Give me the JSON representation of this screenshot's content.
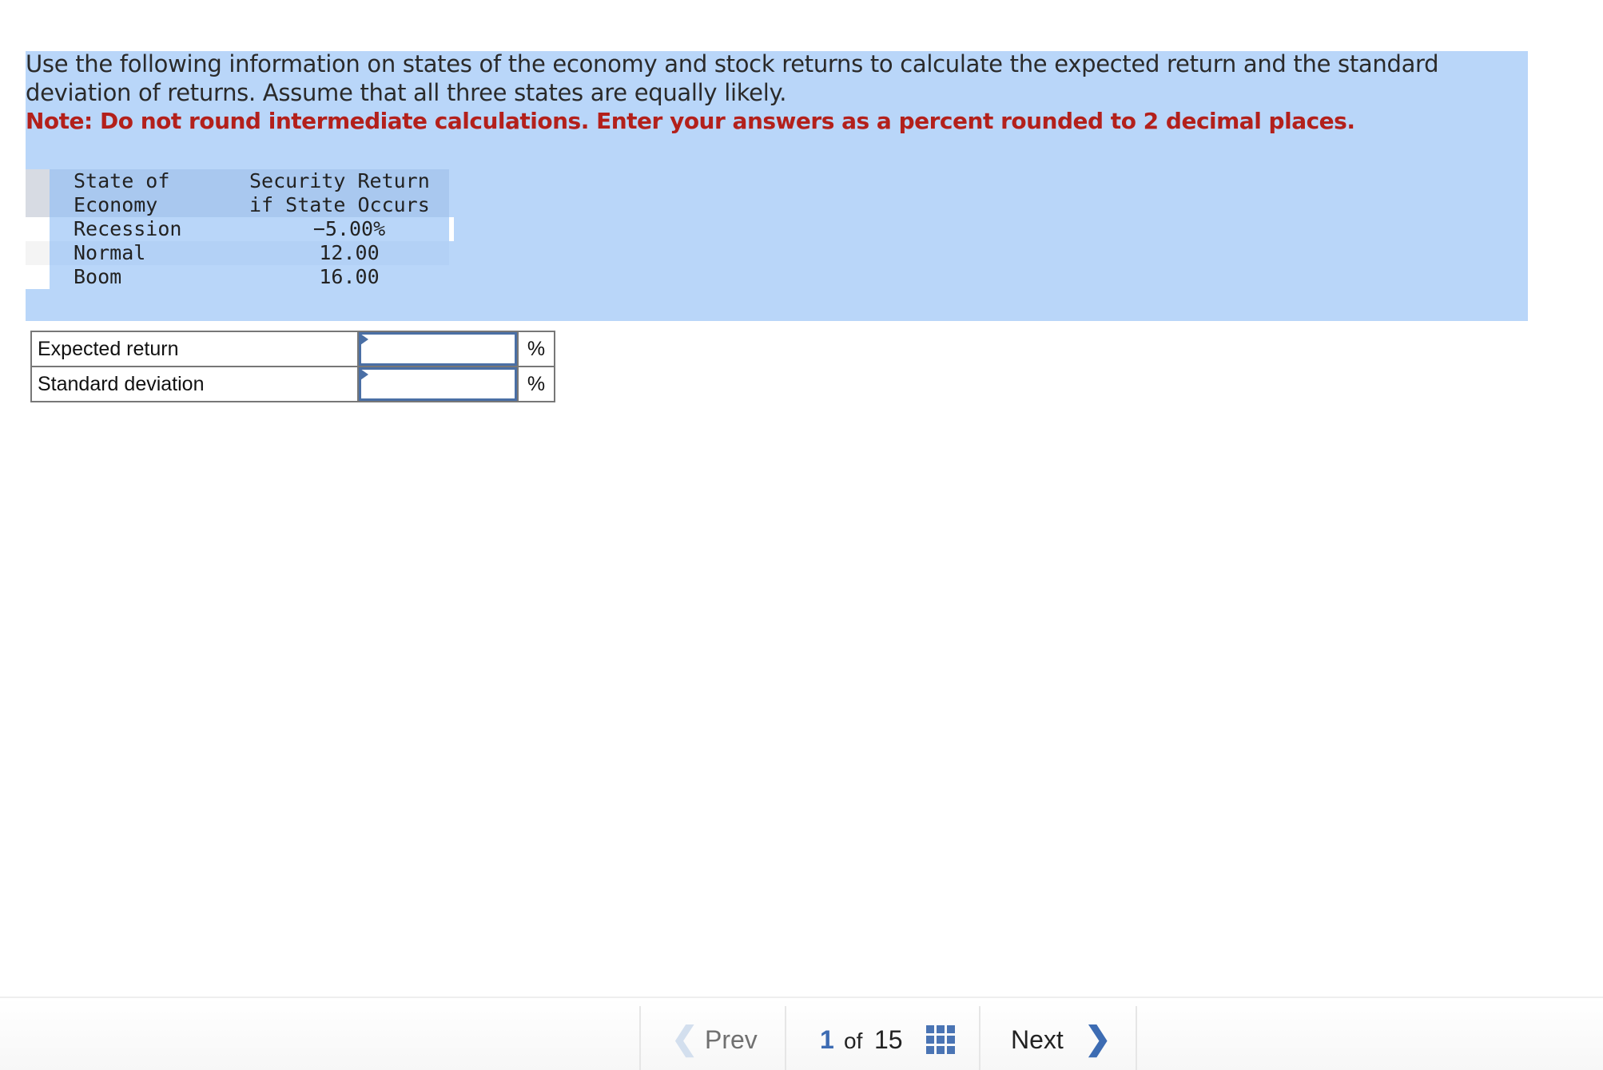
{
  "question": {
    "prompt": "Use the following information on states of the economy and stock returns to calculate the expected return and the standard deviation of returns. Assume that all three states are equally likely.",
    "note": "Note: Do not round intermediate calculations. Enter your answers as a percent rounded to 2 decimal places.",
    "highlight_color": "#b9d6f9",
    "note_color": "#b3201b"
  },
  "data_table": {
    "headers": [
      "State of\nEconomy",
      "Security Return\nif State Occurs"
    ],
    "rows": [
      {
        "state": "Recession",
        "return": "−5.00%"
      },
      {
        "state": "Normal",
        "return": "12.00"
      },
      {
        "state": "Boom",
        "return": "16.00"
      }
    ]
  },
  "answers": {
    "rows": [
      {
        "label": "Expected return",
        "value": "",
        "unit": "%"
      },
      {
        "label": "Standard deviation",
        "value": "",
        "unit": "%"
      }
    ]
  },
  "footer": {
    "prev_label": "Prev",
    "current_page": "1",
    "of_label": "of",
    "total_pages": "15",
    "next_label": "Next",
    "accent_color": "#3d6cb3"
  }
}
